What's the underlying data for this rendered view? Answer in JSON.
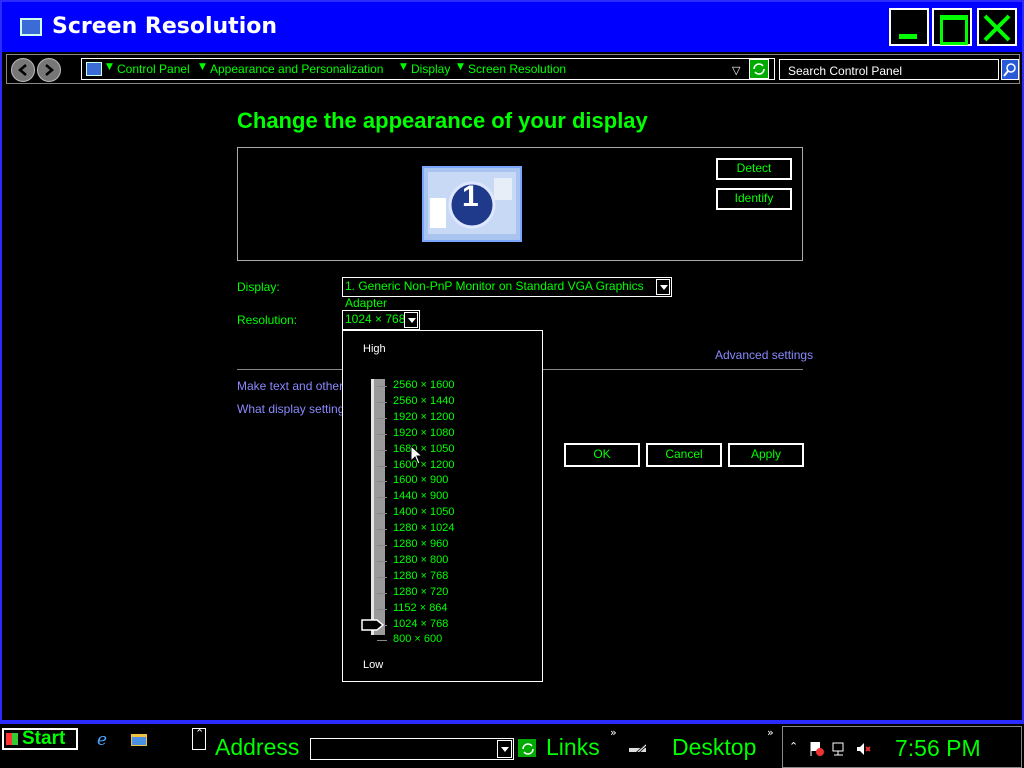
{
  "window": {
    "title": "Screen Resolution"
  },
  "breadcrumb": [
    "Control Panel",
    "Appearance and Personalization",
    "Display",
    "Screen Resolution"
  ],
  "search": {
    "placeholder": "Search Control Panel"
  },
  "heading": "Change the appearance of your display",
  "monitor": {
    "number": "1"
  },
  "buttons": {
    "detect": "Detect",
    "identify": "Identify",
    "ok": "OK",
    "cancel": "Cancel",
    "apply": "Apply"
  },
  "display_label": "Display:",
  "display_value": "1. Generic Non-PnP Monitor on Standard VGA Graphics Adapter",
  "resolution_label": "Resolution:",
  "resolution_value": "1024 × 768",
  "advanced_link": "Advanced settings",
  "links": [
    "Make text and other it",
    "What display settings s"
  ],
  "resolution_popup": {
    "high_label": "High",
    "low_label": "Low",
    "options": [
      "2560 × 1600",
      "2560 × 1440",
      "1920 × 1200",
      "1920 × 1080",
      "1680 × 1050",
      "1600 × 1200",
      "1600 × 900",
      "1440 × 900",
      "1400 × 1050",
      "1280 × 1024",
      "1280 × 960",
      "1280 × 800",
      "1280 × 768",
      "1280 × 720",
      "1152 × 864",
      "1024 × 768",
      "800 × 600"
    ],
    "selected": "1024 × 768"
  },
  "taskbar": {
    "start": "Start",
    "address_label": "Address",
    "links_label": "Links",
    "desktop_label": "Desktop",
    "clock": "7:56 PM"
  },
  "colors": {
    "accent": "#00ff00",
    "title_bar": "#0000ff",
    "link": "#8a8aff",
    "background": "#000000"
  }
}
